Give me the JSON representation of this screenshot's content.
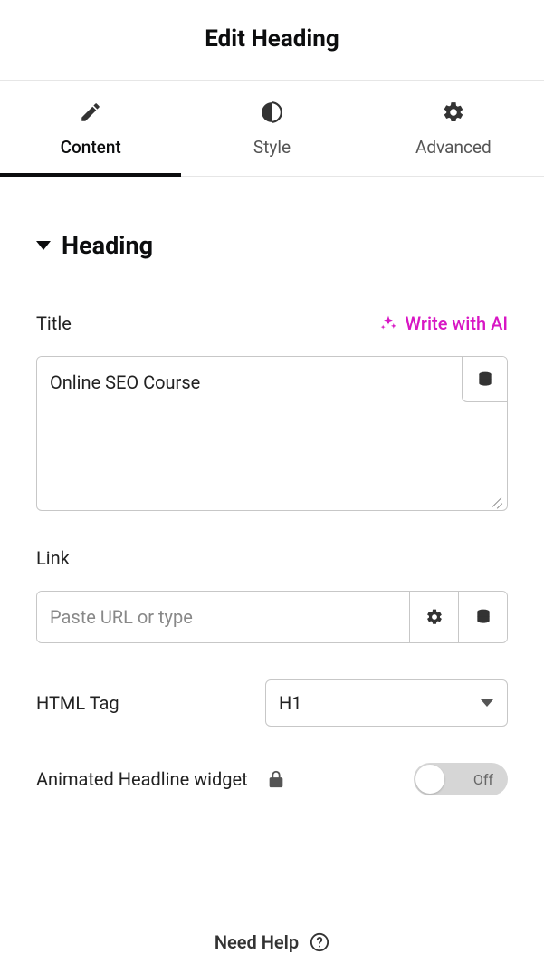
{
  "header": {
    "title": "Edit Heading"
  },
  "tabs": {
    "content": "Content",
    "style": "Style",
    "advanced": "Advanced"
  },
  "section": {
    "title": "Heading"
  },
  "title": {
    "label": "Title",
    "ai_label": "Write with AI",
    "value": "Online SEO Course"
  },
  "link": {
    "label": "Link",
    "placeholder": "Paste URL or type",
    "value": ""
  },
  "html_tag": {
    "label": "HTML Tag",
    "value": "H1"
  },
  "animated": {
    "label": "Animated Headline widget",
    "state_label": "Off"
  },
  "help": {
    "label": "Need Help"
  }
}
